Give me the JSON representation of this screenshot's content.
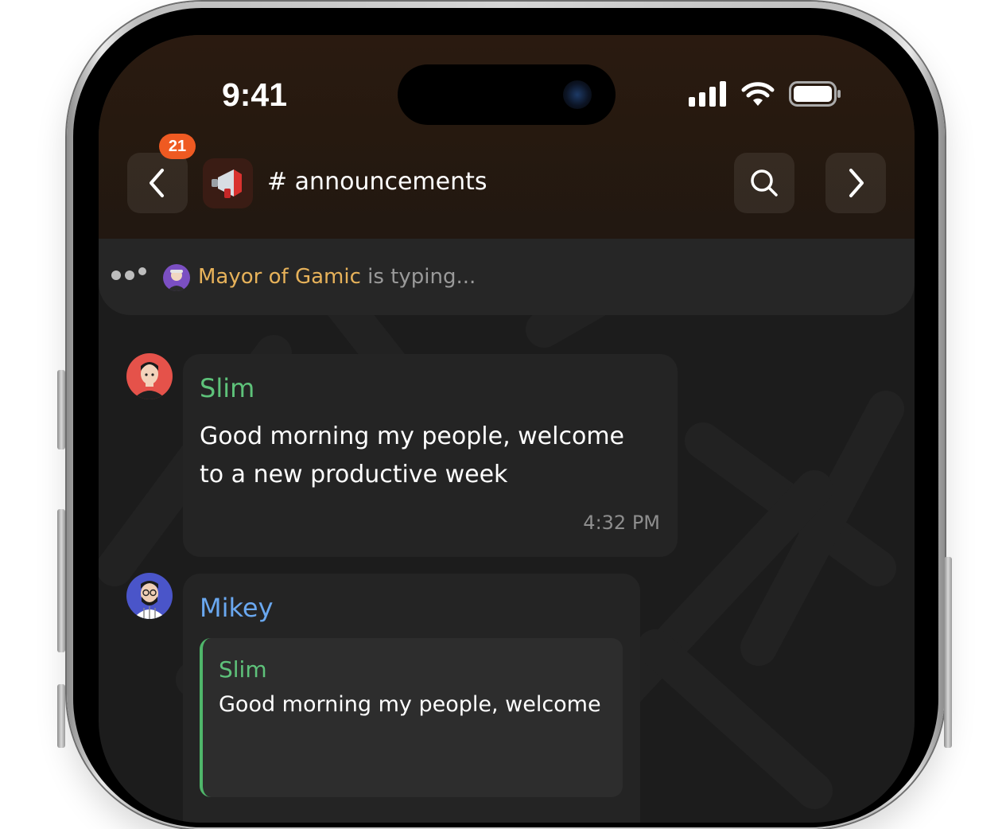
{
  "status_bar": {
    "time": "9:41",
    "icons": [
      "signal-icon",
      "wifi-icon",
      "battery-icon"
    ]
  },
  "header": {
    "unread_count": "21",
    "channel_icon": "megaphone-icon",
    "channel_name": "# announcements",
    "actions": [
      "search-icon",
      "chevron-right-icon"
    ]
  },
  "typing": {
    "user": "Mayor of Gamic",
    "suffix": " is typing..."
  },
  "messages": [
    {
      "sender": "Slim",
      "sender_color": "#5ec27a",
      "line1": "Good morning my people, welcome",
      "line2": "to a new productive week",
      "time": "4:32 PM"
    },
    {
      "sender": "Mikey",
      "sender_color": "#6aa8f0",
      "quote": {
        "sender": "Slim",
        "text": "Good morning my people, welcome"
      }
    }
  ],
  "colors": {
    "accent_badge": "#ef5a22",
    "typing_name": "#e7b25a"
  }
}
